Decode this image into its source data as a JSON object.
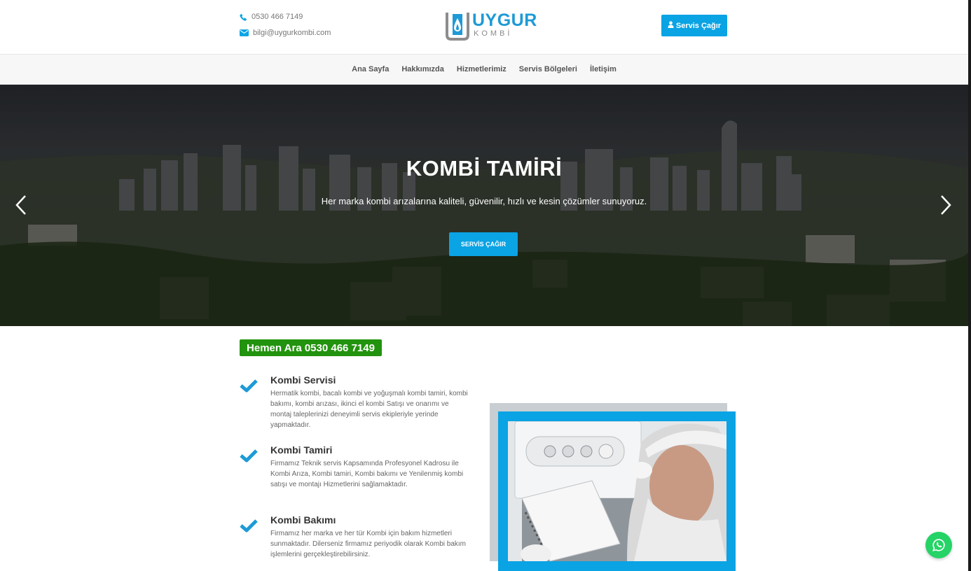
{
  "header": {
    "phone": "0530 466 7149",
    "email": "bilgi@uygurkombi.com",
    "logo_name": "UYGUR",
    "logo_sub": "KOMBİ",
    "cta_label": "Servis Çağır"
  },
  "nav": {
    "items": [
      {
        "label": "Ana Sayfa"
      },
      {
        "label": "Hakkımızda"
      },
      {
        "label": "Hizmetlerimiz"
      },
      {
        "label": "Servis Bölgeleri"
      },
      {
        "label": "İletişim"
      }
    ]
  },
  "hero": {
    "title": "KOMBİ TAMİRİ",
    "subtitle": "Her marka kombi arızalarına kaliteli, güvenilir, hızlı ve kesin çözümler sunuyoruz.",
    "button_label": "SERVİS ÇAĞIR"
  },
  "call_badge": "Hemen Ara 0530 466 7149",
  "features": [
    {
      "title": "Kombi Servisi",
      "desc": "Hermatik kombi, bacalı kombi ve yoğuşmalı kombi tamiri, kombi bakımı, kombi arızası, ikinci el kombi Satışı ve onarımı ve montaj taleplerinizi deneyimli servis ekipleriyle yerinde yapmaktadır."
    },
    {
      "title": "Kombi Tamiri",
      "desc": "Firmamız Teknik servis Kapsamında Profesyonel Kadrosu ile Kombi Arıza, Kombi tamiri, Kombi bakımı ve Yenilenmiş kombi satışı ve montajı Hizmetlerini sağlamaktadır."
    },
    {
      "title": "Kombi Bakımı",
      "desc": "Firmamız her marka ve her tür Kombi için bakım hizmetleri sunmaktadır. Dilerseniz firmamız periyodik olarak Kombi bakım işlemlerini gerçekleştirebilirsiniz."
    }
  ],
  "colors": {
    "accent": "#0aa3e4",
    "call_green": "#22930e",
    "whatsapp": "#25d366",
    "check_blue": "#1e9ad6"
  }
}
